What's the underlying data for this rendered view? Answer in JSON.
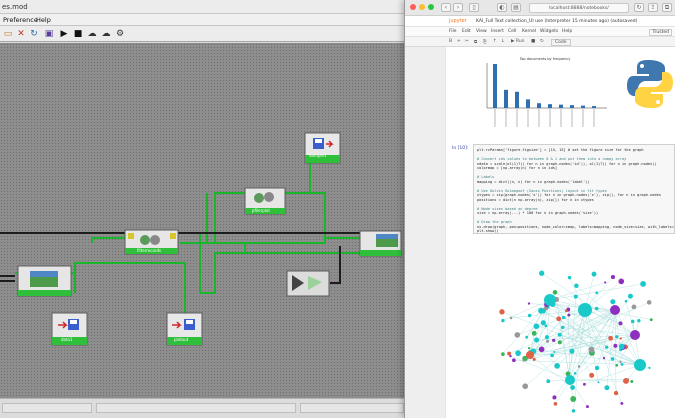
{
  "workflow_app": {
    "title": "es.mod",
    "menu": [
      "Preference",
      "Help"
    ],
    "toolbar_icons": [
      "folder-open-icon",
      "delete-icon",
      "refresh-icon",
      "notebook-icon",
      "run-icon",
      "stop-icon",
      "cloud-download-icon",
      "cloud-icon",
      "cloud-settings-icon"
    ],
    "nodes": {
      "node_save_top": "Sample1",
      "node_process_center": "pfilerplot",
      "node_process_left": "filterrecords",
      "node_save_left": "data1",
      "node_save_bottom": "plotout"
    }
  },
  "browser": {
    "url": "localhost:8888/notebooks/",
    "tab_title": "KAI_Full Text collection_UI use (Interpreter 15 minutes ago) (autosaved)",
    "jupyter_label": "jupyter",
    "menu": [
      "File",
      "Edit",
      "View",
      "Insert",
      "Cell",
      "Kernel",
      "Widgets",
      "Help"
    ],
    "kernel": "Trusted",
    "toolbar_buttons": [
      "B",
      "+",
      "✂",
      "⧉",
      "⎘",
      "↑",
      "↓",
      "▶ Run",
      "■",
      "↻",
      "Code"
    ],
    "cell_prompt": "In [10]:",
    "code_lines": [
      {
        "text": "plt.rcParams['figure.figsize'] = [15, 15] # set the figure size for the graph",
        "comment": false
      },
      {
        "text": "",
        "comment": false
      },
      {
        "text": "# Convert ids values to between 0 & 1 and put them into a numpy array",
        "comment": true
      },
      {
        "text": "ndata = scale(ol(1)?)) for n in graph.nodes('id')), ol(1)?)) for n in graph.nodes()",
        "comment": false
      },
      {
        "text": "colormap = [np.array(n) for n in ids]",
        "comment": false
      },
      {
        "text": "",
        "comment": false
      },
      {
        "text": "# Labels",
        "comment": true
      },
      {
        "text": "mapping = dict((n, n) for n in graph.nodes('label'))",
        "comment": false
      },
      {
        "text": "",
        "comment": false
      },
      {
        "text": "# Use Kolvin Kolmogoof (Gauss Positions) layout in fit types",
        "comment": true
      },
      {
        "text": "xtypes = zip(graph.nodes('x')) for n in graph.nodes('x'), zip(), for n in graph.nodes",
        "comment": false
      },
      {
        "text": "positions = dict(n np.array(n), zip()) for n in xtypes",
        "comment": false
      },
      {
        "text": "",
        "comment": false
      },
      {
        "text": "# Node sizes based on degree",
        "comment": true
      },
      {
        "text": "size = np.array(...) * 100 for n in graph.nodes('size'))",
        "comment": false
      },
      {
        "text": "",
        "comment": false
      },
      {
        "text": "# Draw the graph",
        "comment": true
      },
      {
        "text": "nx.draw(graph, pos=positions, node_color=cmap, labels=mapping, node_size=size, with_labels=",
        "comment": false
      },
      {
        "text": "plt.show()",
        "comment": false
      }
    ],
    "chart_title": "Top documents by frequency",
    "bar_values": [
      92,
      38,
      34,
      18,
      10,
      8,
      7,
      6,
      5,
      4
    ],
    "bar_color": "#2f6fb0"
  }
}
